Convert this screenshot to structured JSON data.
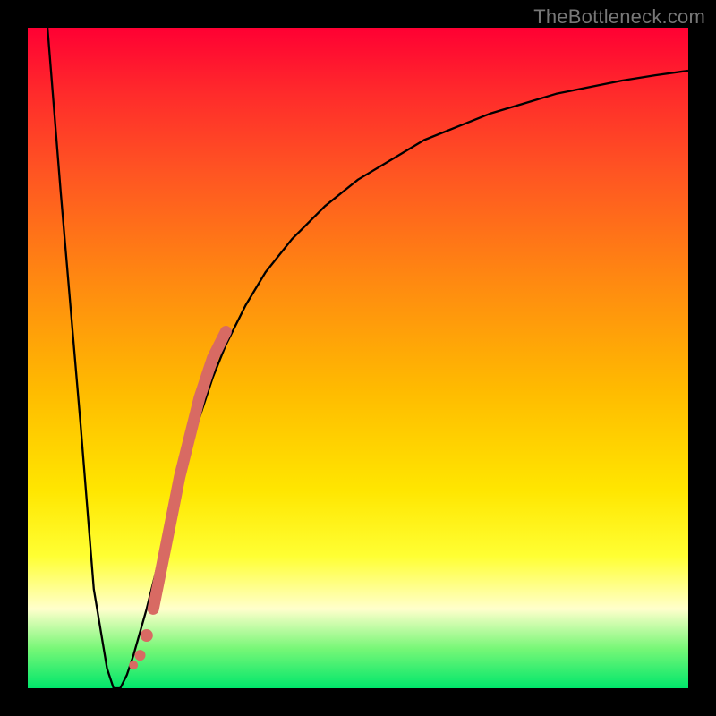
{
  "watermark": "TheBottleneck.com",
  "colors": {
    "frame_bg": "#000000",
    "curve_stroke": "#000000",
    "marker_fill": "#d86a63",
    "gradient_top": "#ff0033",
    "gradient_bottom": "#00e66b"
  },
  "chart_data": {
    "type": "line",
    "title": "",
    "xlabel": "",
    "ylabel": "",
    "xlim": [
      0,
      100
    ],
    "ylim": [
      0,
      100
    ],
    "x": [
      3,
      5,
      8,
      10,
      12,
      13,
      14,
      15,
      16,
      18,
      20,
      22,
      24,
      26,
      28,
      30,
      33,
      36,
      40,
      45,
      50,
      55,
      60,
      65,
      70,
      75,
      80,
      85,
      90,
      95,
      100
    ],
    "values": [
      100,
      75,
      40,
      15,
      3,
      0,
      0,
      2,
      5,
      12,
      20,
      28,
      35,
      41,
      47,
      52,
      58,
      63,
      68,
      73,
      77,
      80,
      83,
      85,
      87,
      88.5,
      90,
      91,
      92,
      92.8,
      93.5
    ],
    "markers": {
      "x": [
        16,
        17,
        18,
        19,
        20,
        21,
        22,
        23,
        24,
        25,
        26,
        27,
        28,
        29,
        30
      ],
      "values": [
        3.5,
        5,
        8,
        12,
        17,
        22,
        27,
        32,
        36,
        40,
        44,
        47,
        50,
        52,
        54
      ]
    },
    "annotations": []
  }
}
